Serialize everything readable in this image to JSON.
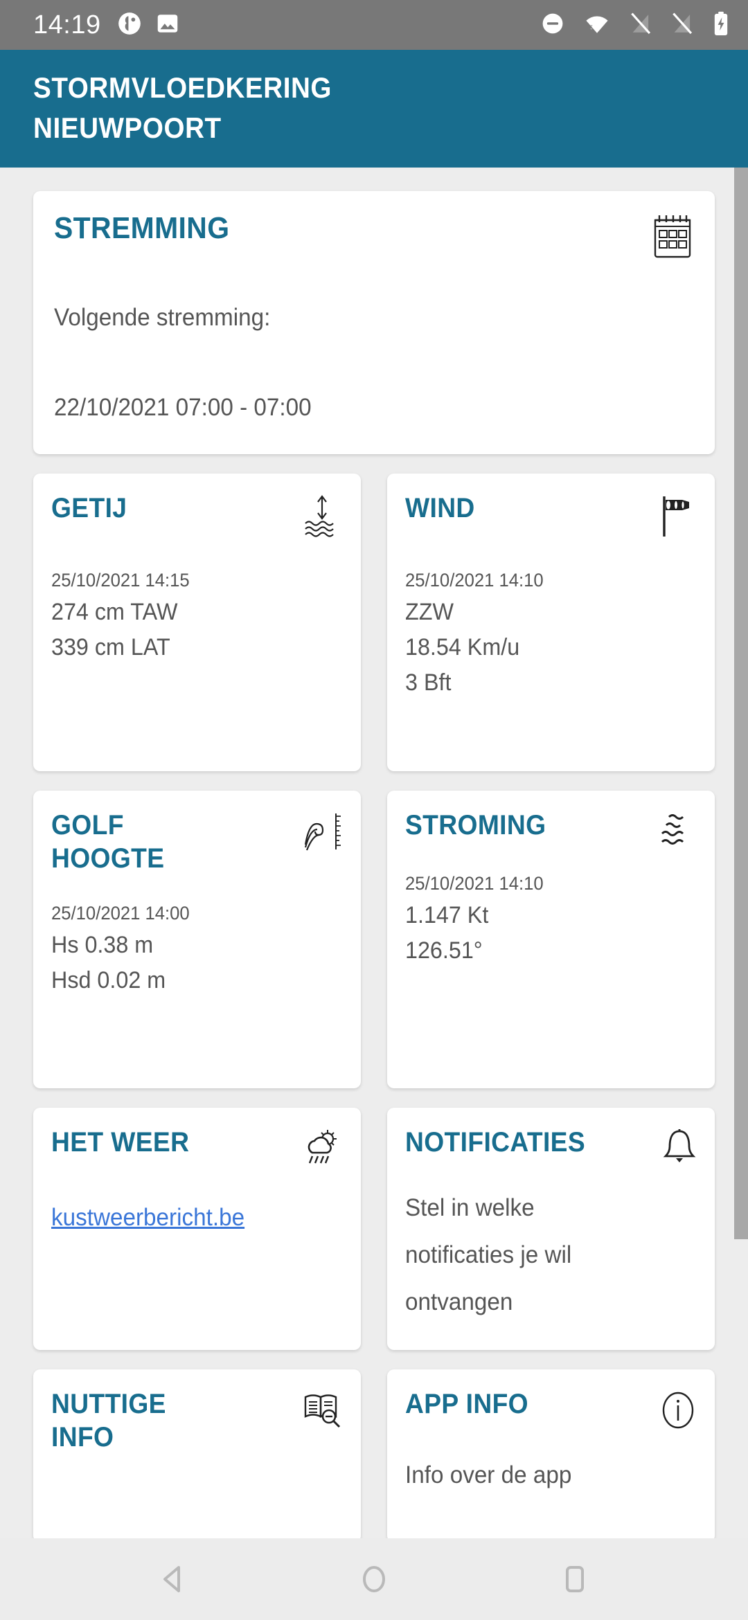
{
  "status_bar": {
    "time": "14:19",
    "left_icons": [
      "app-badge-icon",
      "image-icon"
    ],
    "right_icons": [
      "do-not-disturb-icon",
      "wifi-icon",
      "signal-off-icon",
      "signal-off-2-icon",
      "battery-charging-icon"
    ],
    "background": "#787878"
  },
  "header": {
    "line1": "STORMVLOEDKERING",
    "line2": "NIEUWPOORT",
    "background": "#186d8e",
    "text_color": "#ffffff"
  },
  "theme": {
    "accent": "#186d8e",
    "page_background": "#ededed",
    "card_background": "#ffffff",
    "body_text": "#555555",
    "link_color": "#3a76d8",
    "scrollbar": "#a8a8a8"
  },
  "cards": {
    "stremming": {
      "title": "STREMMING",
      "icon": "calendar-icon",
      "label": "Volgende stremming:",
      "value": "22/10/2021 07:00 - 07:00"
    },
    "getij": {
      "title": "GETIJ",
      "icon": "tide-level-icon",
      "timestamp": "25/10/2021 14:15",
      "value1": "274 cm TAW",
      "value2": "339 cm LAT"
    },
    "wind": {
      "title": "WIND",
      "icon": "windsock-icon",
      "timestamp": "25/10/2021 14:10",
      "value1": "ZZW",
      "value2": "18.54 Km/u",
      "value3": "3 Bft"
    },
    "golfhoogte": {
      "title_line1": "GOLF",
      "title_line2": "HOOGTE",
      "icon": "wave-height-icon",
      "timestamp": "25/10/2021 14:00",
      "value1": "Hs 0.38 m",
      "value2": "Hsd 0.02 m"
    },
    "stroming": {
      "title": "STROMING",
      "icon": "current-waves-icon",
      "timestamp": "25/10/2021 14:10",
      "value1": "1.147 Kt",
      "value2": "126.51°"
    },
    "hetweer": {
      "title": "HET WEER",
      "icon": "sun-cloud-rain-icon",
      "link": "kustweerbericht.be"
    },
    "notificaties": {
      "title": "NOTIFICATIES",
      "icon": "bell-icon",
      "line1": "Stel in welke",
      "line2": "notificaties je wil",
      "line3": "ontvangen"
    },
    "nuttige_info": {
      "title_line1": "NUTTIGE",
      "title_line2": "INFO",
      "icon": "book-search-icon"
    },
    "app_info": {
      "title": "APP INFO",
      "icon": "info-circle-icon",
      "text": "Info over de app"
    }
  },
  "nav_bar": {
    "buttons": [
      "back-nav-button",
      "home-nav-button",
      "recents-nav-button"
    ],
    "background": "#ececec"
  }
}
